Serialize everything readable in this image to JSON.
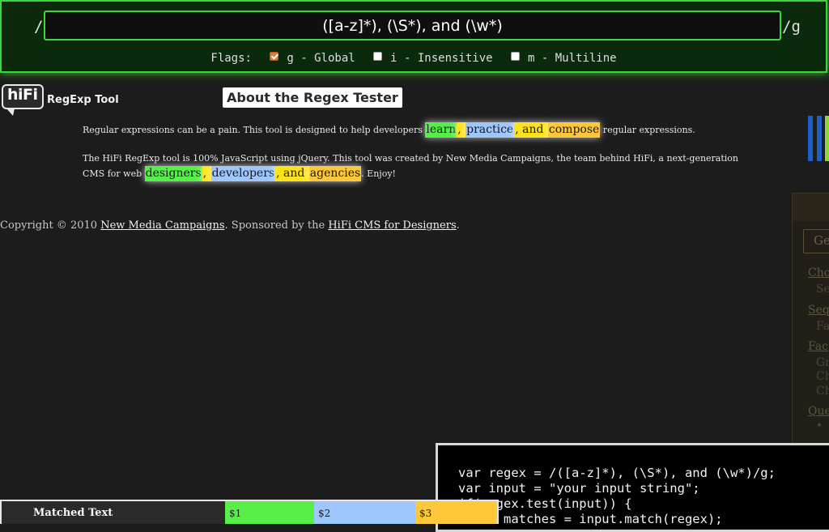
{
  "regex_bar": {
    "slash_open": "/",
    "pattern": "([a-z]*), (\\S*), and (\\w*)",
    "slash_close": "/g",
    "flags_label": "Flags:",
    "flags": [
      {
        "label": "g - Global",
        "checked": true
      },
      {
        "label": "i - Insensitive",
        "checked": false
      },
      {
        "label": "m - Multiline",
        "checked": false
      }
    ]
  },
  "logo": {
    "text": "hiFi",
    "tool_name": "RegExp Tool"
  },
  "about": {
    "title": "About the Regex Tester",
    "para1": {
      "before": "Regular expressions can be a pain. This tool is designed to help developers ",
      "m1": "learn",
      "s1": ", ",
      "m2": "practice",
      "s2": ", and ",
      "m3": "compose",
      "after": " regular expressions."
    },
    "para2": {
      "before": "The HiFi RegExp tool is 100% JavaScript using jQuery. This tool was created by New Media Campaigns, the team behind HiFi, a next-generation CMS for web ",
      "m1": "designers",
      "s1": ", ",
      "m2": "developers",
      "s2": ", and ",
      "m3": "agencies",
      "after": ". Enjoy!"
    }
  },
  "footer": {
    "prefix": "Copyright © 2010 ",
    "link1": "New Media Campaigns",
    "middle": ". Sponsored by the ",
    "link2": "HiFi CMS for Designers",
    "suffix": "."
  },
  "side_panel": {
    "button": "Ge",
    "items": [
      {
        "text": "Cho",
        "type": "link"
      },
      {
        "text": "Se",
        "type": "sub"
      },
      {
        "text": "Seq",
        "type": "link"
      },
      {
        "text": "Fa",
        "type": "sub"
      },
      {
        "text": "Fac",
        "type": "link"
      },
      {
        "text": "Gr",
        "type": "sub"
      },
      {
        "text": "Ch",
        "type": "sub"
      },
      {
        "text": "Ch",
        "type": "sub"
      },
      {
        "text": "Que",
        "type": "link"
      },
      {
        "text": "•",
        "type": "sub"
      }
    ]
  },
  "code": {
    "lines": [
      "var regex = /([a-z]*), (\\S*), and (\\w*)/g;",
      "var input = \"your input string\";",
      "if(regex.test(input)) {",
      "  var matches = input.match(regex);"
    ]
  },
  "matched_table": {
    "header": "Matched Text",
    "col1": "$1",
    "col2": "$2",
    "col3": "$3"
  },
  "colors": {
    "group1": "#55f04a",
    "group2": "#9ec7ff",
    "group3": "#ffe31a",
    "group4": "#ffc83a",
    "accent_green": "#39d739"
  }
}
